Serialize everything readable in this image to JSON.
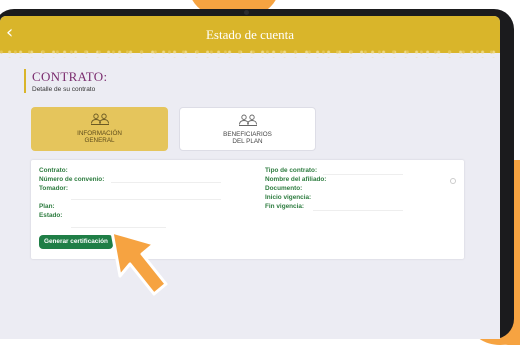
{
  "header": {
    "title": "Estado de cuenta",
    "back_icon": "chevron-left-icon"
  },
  "section": {
    "heading": "CONTRATO:",
    "subheading": "Detalle de su contrato"
  },
  "tabs": [
    {
      "label_line1": "INFORMACIÓN",
      "label_line2": "GENERAL",
      "icon": "users-icon",
      "active": true
    },
    {
      "label_line1": "BENEFICIARIOS",
      "label_line2": "DEL PLAN",
      "icon": "users-icon",
      "active": false
    }
  ],
  "fields_left": [
    "Contrato:",
    "Número de convenio:",
    "Tomador:",
    "Plan:",
    "Estado:"
  ],
  "fields_right": [
    "Tipo de contrato:",
    "Nombre del afiliado:",
    "Documento:",
    "Inicio vigencia:",
    "Fin vigencia:"
  ],
  "actions": {
    "certificate_button": "Generar certificación"
  },
  "colors": {
    "header": "#d9b52a",
    "accent_label": "#2d7c3f",
    "button": "#1f7e46",
    "active_tab": "#e5c55c",
    "pointer": "#f6a341"
  }
}
